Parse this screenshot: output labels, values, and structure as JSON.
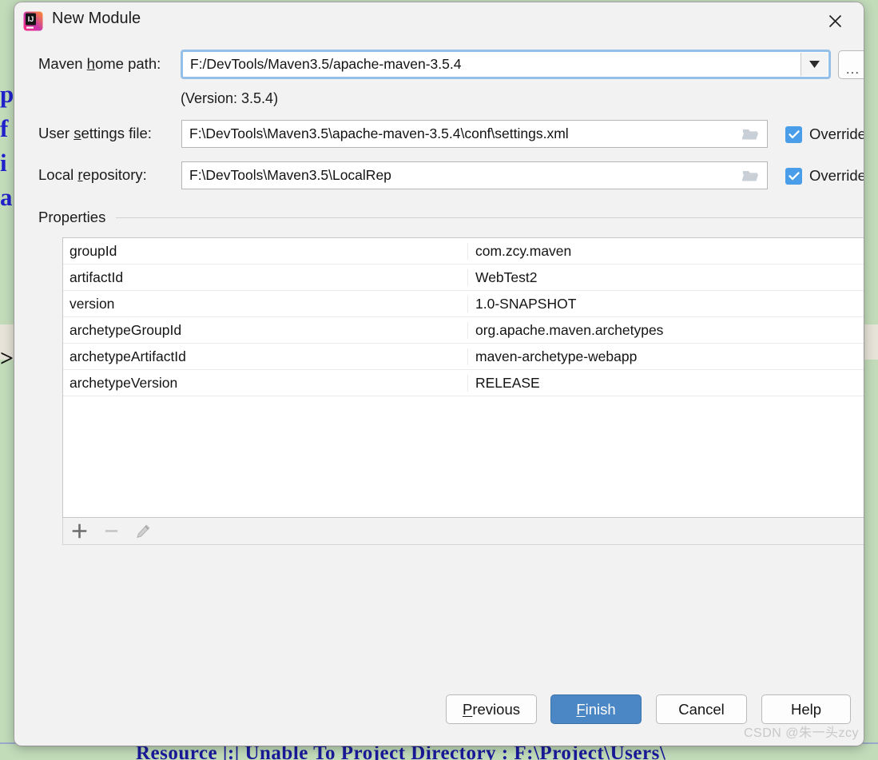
{
  "background": {
    "left_text": "p\nf\ni\na",
    "caret": ">",
    "bottom_text": "Resource   |:| Unable To Project Directory  :  F:\\Project\\Users\\"
  },
  "dialog": {
    "title": "New Module",
    "app_icon": "intellij-idea-icon",
    "close_icon": "close-icon"
  },
  "form": {
    "maven_home": {
      "label_pre": "Maven ",
      "label_mnemonic": "h",
      "label_post": "ome path:",
      "value": "F:/DevTools/Maven3.5/apache-maven-3.5.4",
      "dropdown_icon": "chevron-down-icon",
      "browse_label": "...",
      "version_note": "(Version: 3.5.4)"
    },
    "user_settings": {
      "label_pre": "User ",
      "label_mnemonic": "s",
      "label_post": "ettings file:",
      "value": "F:\\DevTools\\Maven3.5\\apache-maven-3.5.4\\conf\\settings.xml",
      "folder_icon": "folder-icon",
      "override_label": "Override",
      "override_checked": true
    },
    "local_repository": {
      "label_pre": "Local ",
      "label_mnemonic": "r",
      "label_post": "epository:",
      "value": "F:\\DevTools\\Maven3.5\\LocalRep",
      "folder_icon": "folder-icon",
      "override_label": "Override",
      "override_checked": true
    }
  },
  "properties": {
    "title": "Properties",
    "rows": [
      {
        "key": "groupId",
        "value": "com.zcy.maven"
      },
      {
        "key": "artifactId",
        "value": "WebTest2"
      },
      {
        "key": "version",
        "value": "1.0-SNAPSHOT"
      },
      {
        "key": "archetypeGroupId",
        "value": "org.apache.maven.archetypes"
      },
      {
        "key": "archetypeArtifactId",
        "value": "maven-archetype-webapp"
      },
      {
        "key": "archetypeVersion",
        "value": "RELEASE"
      }
    ],
    "toolbar": {
      "add_icon": "plus-icon",
      "remove_icon": "minus-icon",
      "edit_icon": "pencil-icon"
    }
  },
  "footer": {
    "previous": {
      "pre": "",
      "mnemonic": "P",
      "post": "revious"
    },
    "finish": {
      "pre": "",
      "mnemonic": "F",
      "post": "inish"
    },
    "cancel": {
      "label": "Cancel"
    },
    "help": {
      "label": "Help"
    }
  },
  "watermark": "CSDN @朱一头zcy",
  "colors": {
    "accent_blue": "#4b87c4",
    "checkbox_blue": "#4a9de8",
    "focus_ring": "#94bfe8",
    "page_green": "#c2dcba"
  }
}
